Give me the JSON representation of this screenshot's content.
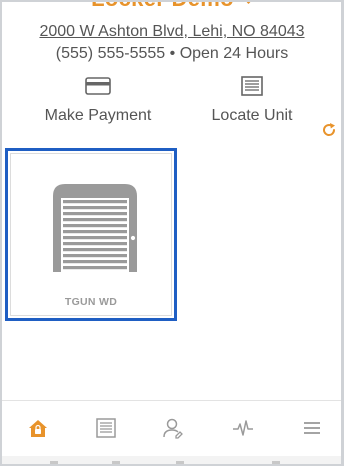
{
  "header": {
    "title": "Locker Demo",
    "address": "2000 W Ashton Blvd, Lehi, NO 84043",
    "phone_hours": "(555) 555-5555 • Open 24 Hours"
  },
  "actions": {
    "make_payment": {
      "label": "Make Payment",
      "icon": "credit-card-icon"
    },
    "locate_unit": {
      "label": "Locate Unit",
      "icon": "storage-door-icon"
    }
  },
  "units": [
    {
      "name": "TGUN WD",
      "icon": "storage-unit-door-icon",
      "selected": true
    }
  ],
  "tab_bar": {
    "items": [
      {
        "icon": "home-lock-icon",
        "active": true
      },
      {
        "icon": "units-icon",
        "active": false
      },
      {
        "icon": "account-icon",
        "active": false
      },
      {
        "icon": "activity-icon",
        "active": false
      },
      {
        "icon": "menu-icon",
        "active": false
      }
    ]
  },
  "colors": {
    "accent": "#e8932b",
    "selected_border": "#1f5ec3",
    "text": "#555555",
    "icon_gray": "#9a9a9a"
  }
}
